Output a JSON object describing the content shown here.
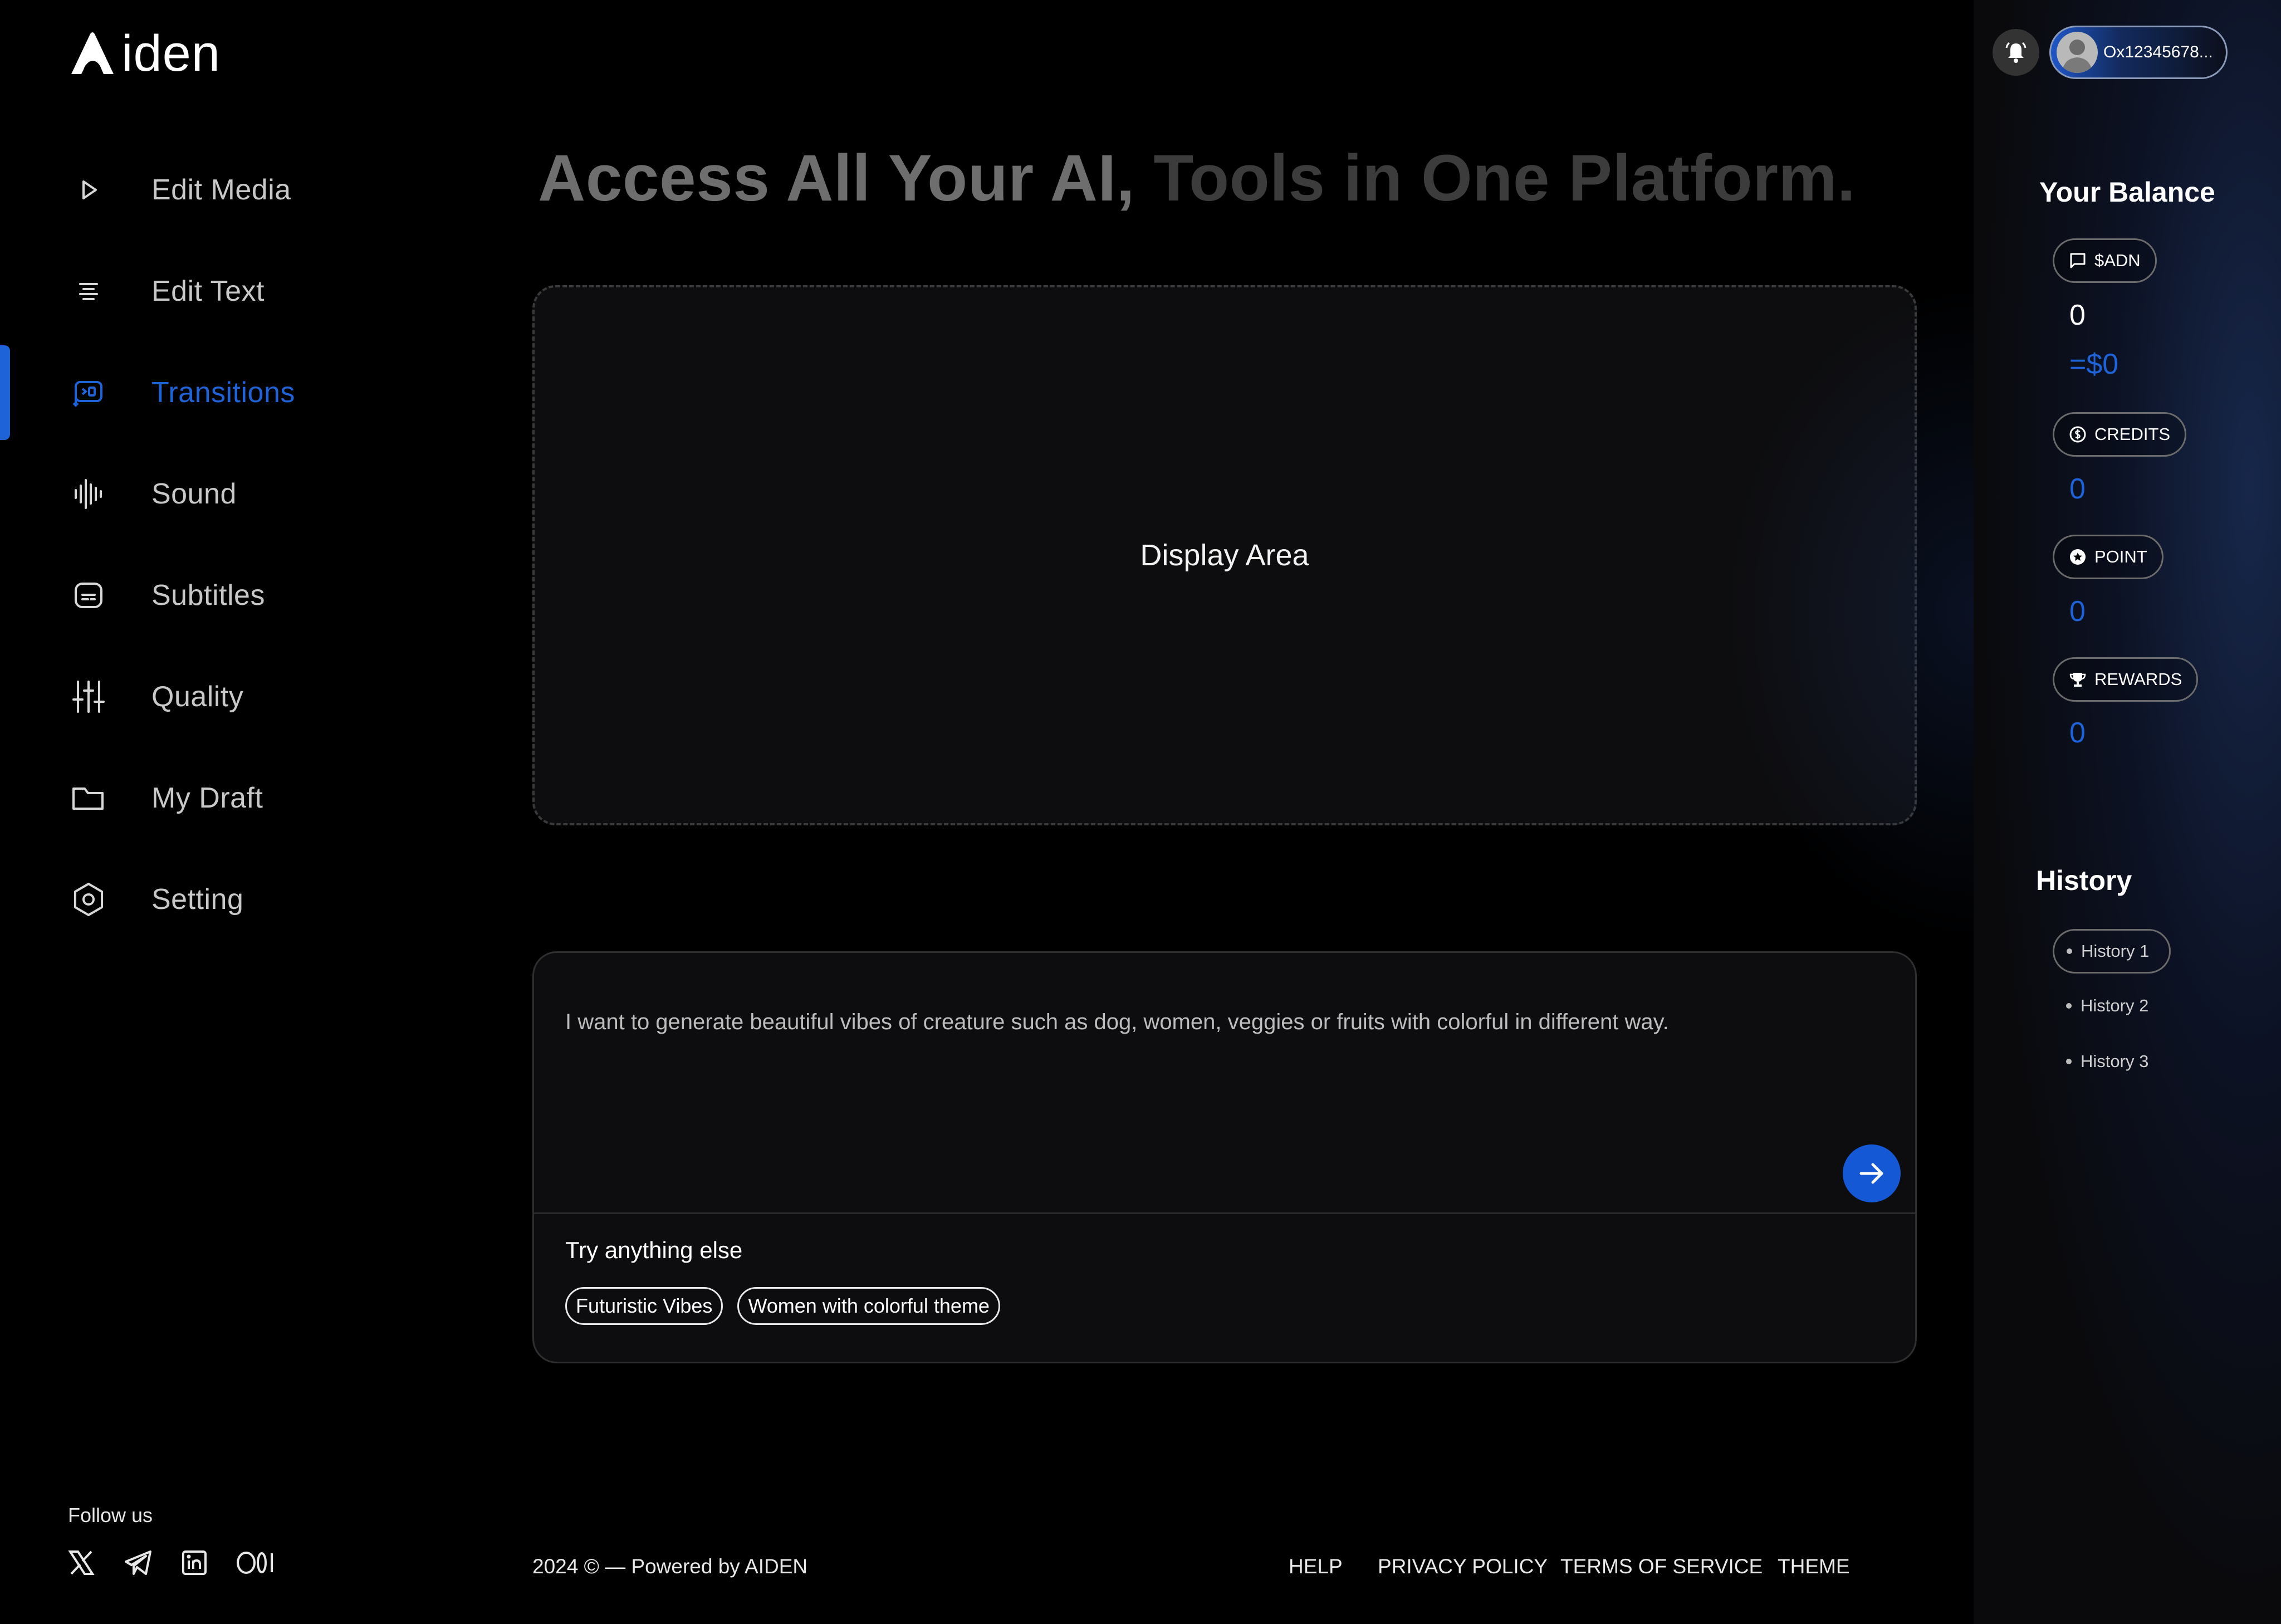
{
  "brand": {
    "name": "iden"
  },
  "sidebar": {
    "items": [
      {
        "label": "Edit Media",
        "icon": "play-icon"
      },
      {
        "label": "Edit Text",
        "icon": "text-align-icon"
      },
      {
        "label": "Transitions",
        "icon": "transitions-icon",
        "active": true
      },
      {
        "label": "Sound",
        "icon": "soundwave-icon"
      },
      {
        "label": "Subtitles",
        "icon": "subtitles-icon"
      },
      {
        "label": "Quality",
        "icon": "sliders-icon"
      },
      {
        "label": "My Draft",
        "icon": "folder-icon"
      },
      {
        "label": "Setting",
        "icon": "hexagon-gear-icon"
      }
    ],
    "follow_label": "Follow us",
    "socials": [
      "x-icon",
      "telegram-icon",
      "linkedin-icon",
      "medium-icon"
    ]
  },
  "main": {
    "headline_part1": "Access All Your AI,",
    "headline_part2": "Tools in One Platform.",
    "display_label": "Display Area",
    "prompt_text": "I want to generate beautiful vibes of creature such as dog, women, veggies or fruits with colorful in different way.",
    "try_label": "Try anything else",
    "suggestions": [
      "Futuristic Vibes",
      "Women with colorful theme"
    ]
  },
  "footer": {
    "copyright": "2024 © — Powered by AIDEN",
    "links": [
      "HELP",
      "PRIVACY POLICY",
      "TERMS OF SERVICE",
      "THEME"
    ]
  },
  "header": {
    "wallet_address": "Ox12345678..."
  },
  "balance": {
    "title": "Your Balance",
    "adn": {
      "label": "$ADN",
      "value": "0",
      "usd": "=$0"
    },
    "credits": {
      "label": "CREDITS",
      "value": "0"
    },
    "point": {
      "label": "POINT",
      "value": "0"
    },
    "rewards": {
      "label": "REWARDS",
      "value": "0"
    }
  },
  "history": {
    "title": "History",
    "items": [
      "History 1",
      "History 2",
      "History 3"
    ]
  },
  "colors": {
    "accent": "#1F63D8",
    "send_button": "#1558D6",
    "background": "#000000"
  }
}
